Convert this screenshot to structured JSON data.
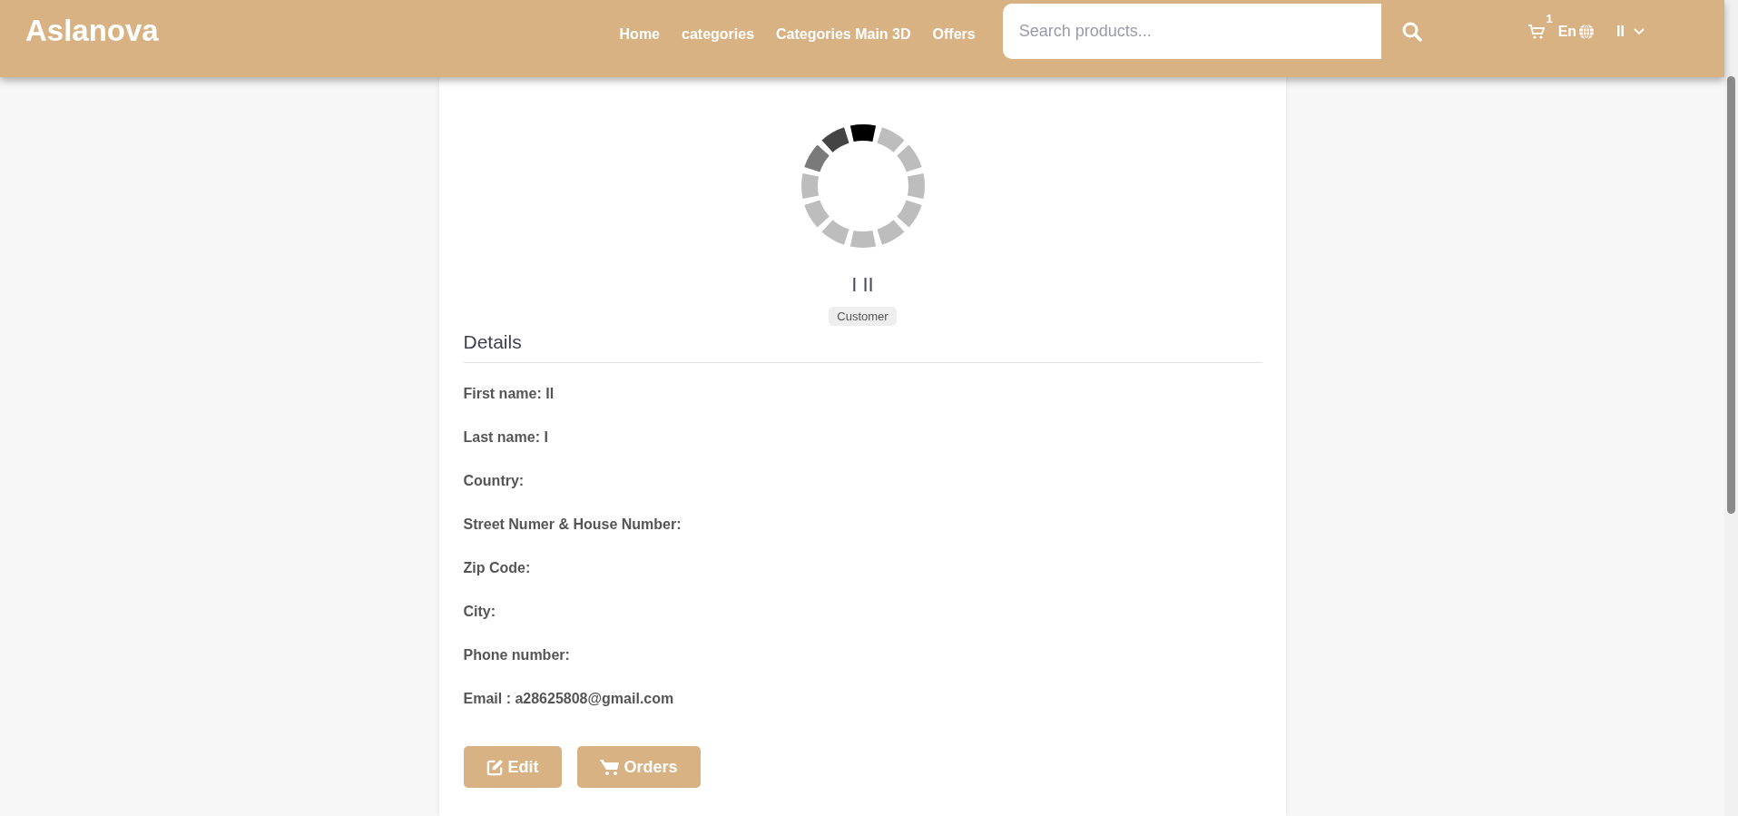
{
  "header": {
    "logo": "Aslanova",
    "nav": [
      "Home",
      "categories",
      "Categories Main 3D",
      "Offers"
    ],
    "search": {
      "placeholder": "Search products..."
    },
    "cart_count": "1",
    "language": "En",
    "user": "II"
  },
  "profile": {
    "name": "I II",
    "role": "Customer",
    "section_title": "Details",
    "details": [
      "First name: II",
      "Last name: I",
      "Country:",
      "Street Numer & House Number:",
      "Zip Code:",
      "City:",
      "Phone number:",
      "Email : a28625808@gmail.com"
    ],
    "buttons": [
      {
        "kind": "edit",
        "label": "Edit"
      },
      {
        "kind": "orders",
        "label": "Orders"
      }
    ]
  }
}
